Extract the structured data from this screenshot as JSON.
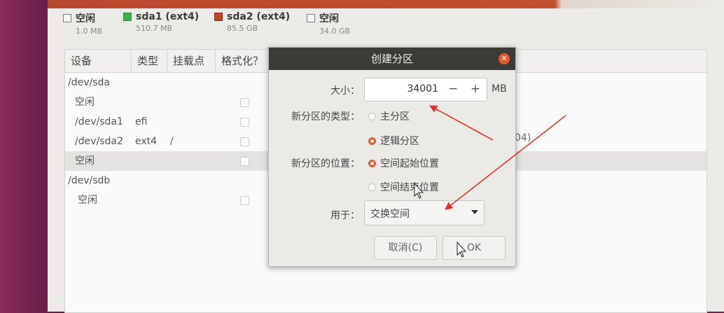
{
  "legend": [
    {
      "swatch": "free",
      "label": "空闲",
      "size": "1.0 MB"
    },
    {
      "swatch": "green",
      "label": "sda1 (ext4)",
      "size": "510.7 MB"
    },
    {
      "swatch": "red",
      "label": "sda2 (ext4)",
      "size": "85.5 GB"
    },
    {
      "swatch": "free",
      "label": "空闲",
      "size": "34.0 GB"
    }
  ],
  "table": {
    "headers": [
      "设备",
      "类型",
      "挂载点",
      "格式化？"
    ],
    "rows": [
      {
        "text": "/dev/sda"
      },
      {
        "text": "空闲"
      },
      {
        "text": "/dev/sda1",
        "type": "efi",
        "mount": ""
      },
      {
        "text": "/dev/sda2",
        "type": "ext4",
        "mount": "/"
      },
      {
        "text": "空闲"
      },
      {
        "text": "/dev/sdb"
      },
      {
        "text": "空闲"
      }
    ],
    "partial_text": "04)"
  },
  "dialog": {
    "title": "创建分区",
    "size_label": "大小：",
    "size_value": "34001",
    "minus": "−",
    "plus": "+",
    "unit": "MB",
    "type_label": "新分区的类型：",
    "type_primary": "主分区",
    "type_logical": "逻辑分区",
    "pos_label": "新分区的位置：",
    "pos_start": "空间起始位置",
    "pos_end": "空间结束位置",
    "use_label": "用于：",
    "use_value": "交换空间",
    "cancel": "取消(C)",
    "ok": "OK"
  },
  "colors": {
    "accent": "#df5a2e",
    "arrow": "#e0342c"
  }
}
